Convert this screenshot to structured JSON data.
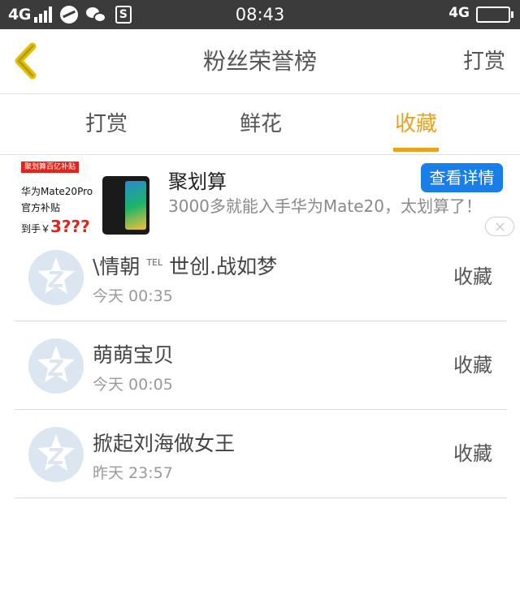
{
  "status_bar": {
    "network": "4G",
    "time": "08:43",
    "network_right": "4G",
    "icons": [
      "signal-icon",
      "browser-icon",
      "wechat-icon",
      "s-app-icon",
      "battery-icon"
    ]
  },
  "header": {
    "back_icon": "chevron-left-icon",
    "title": "粉丝荣誉榜",
    "action": "打赏"
  },
  "tabs": [
    {
      "label": "打赏",
      "active": false
    },
    {
      "label": "鲜花",
      "active": false
    },
    {
      "label": "收藏",
      "active": true
    }
  ],
  "colors": {
    "accent": "#e9a21b",
    "ad_button": "#1a7ee8",
    "status_bar": "#3b3b3b"
  },
  "ad": {
    "image": {
      "tag": "聚划算百亿补贴",
      "line1": "华为Mate20Pro",
      "line2": "官方补贴",
      "line3_prefix": "到手￥",
      "line3_price": "3???"
    },
    "title": "聚划算",
    "button": "查看详情",
    "description": "3000多就能入手华为Mate20，太划算了！",
    "close_icon": "close-icon"
  },
  "list": [
    {
      "name": "\\情朝",
      "superscript": "TEL",
      "name_rest": " 世创.战如梦",
      "time": "今天 00:35",
      "action": "收藏"
    },
    {
      "name": "萌萌宝贝",
      "superscript": "",
      "name_rest": "",
      "time": "今天 00:05",
      "action": "收藏"
    },
    {
      "name": "掀起刘海做女王",
      "superscript": "",
      "name_rest": "",
      "time": "昨天 23:57",
      "action": "收藏"
    }
  ]
}
